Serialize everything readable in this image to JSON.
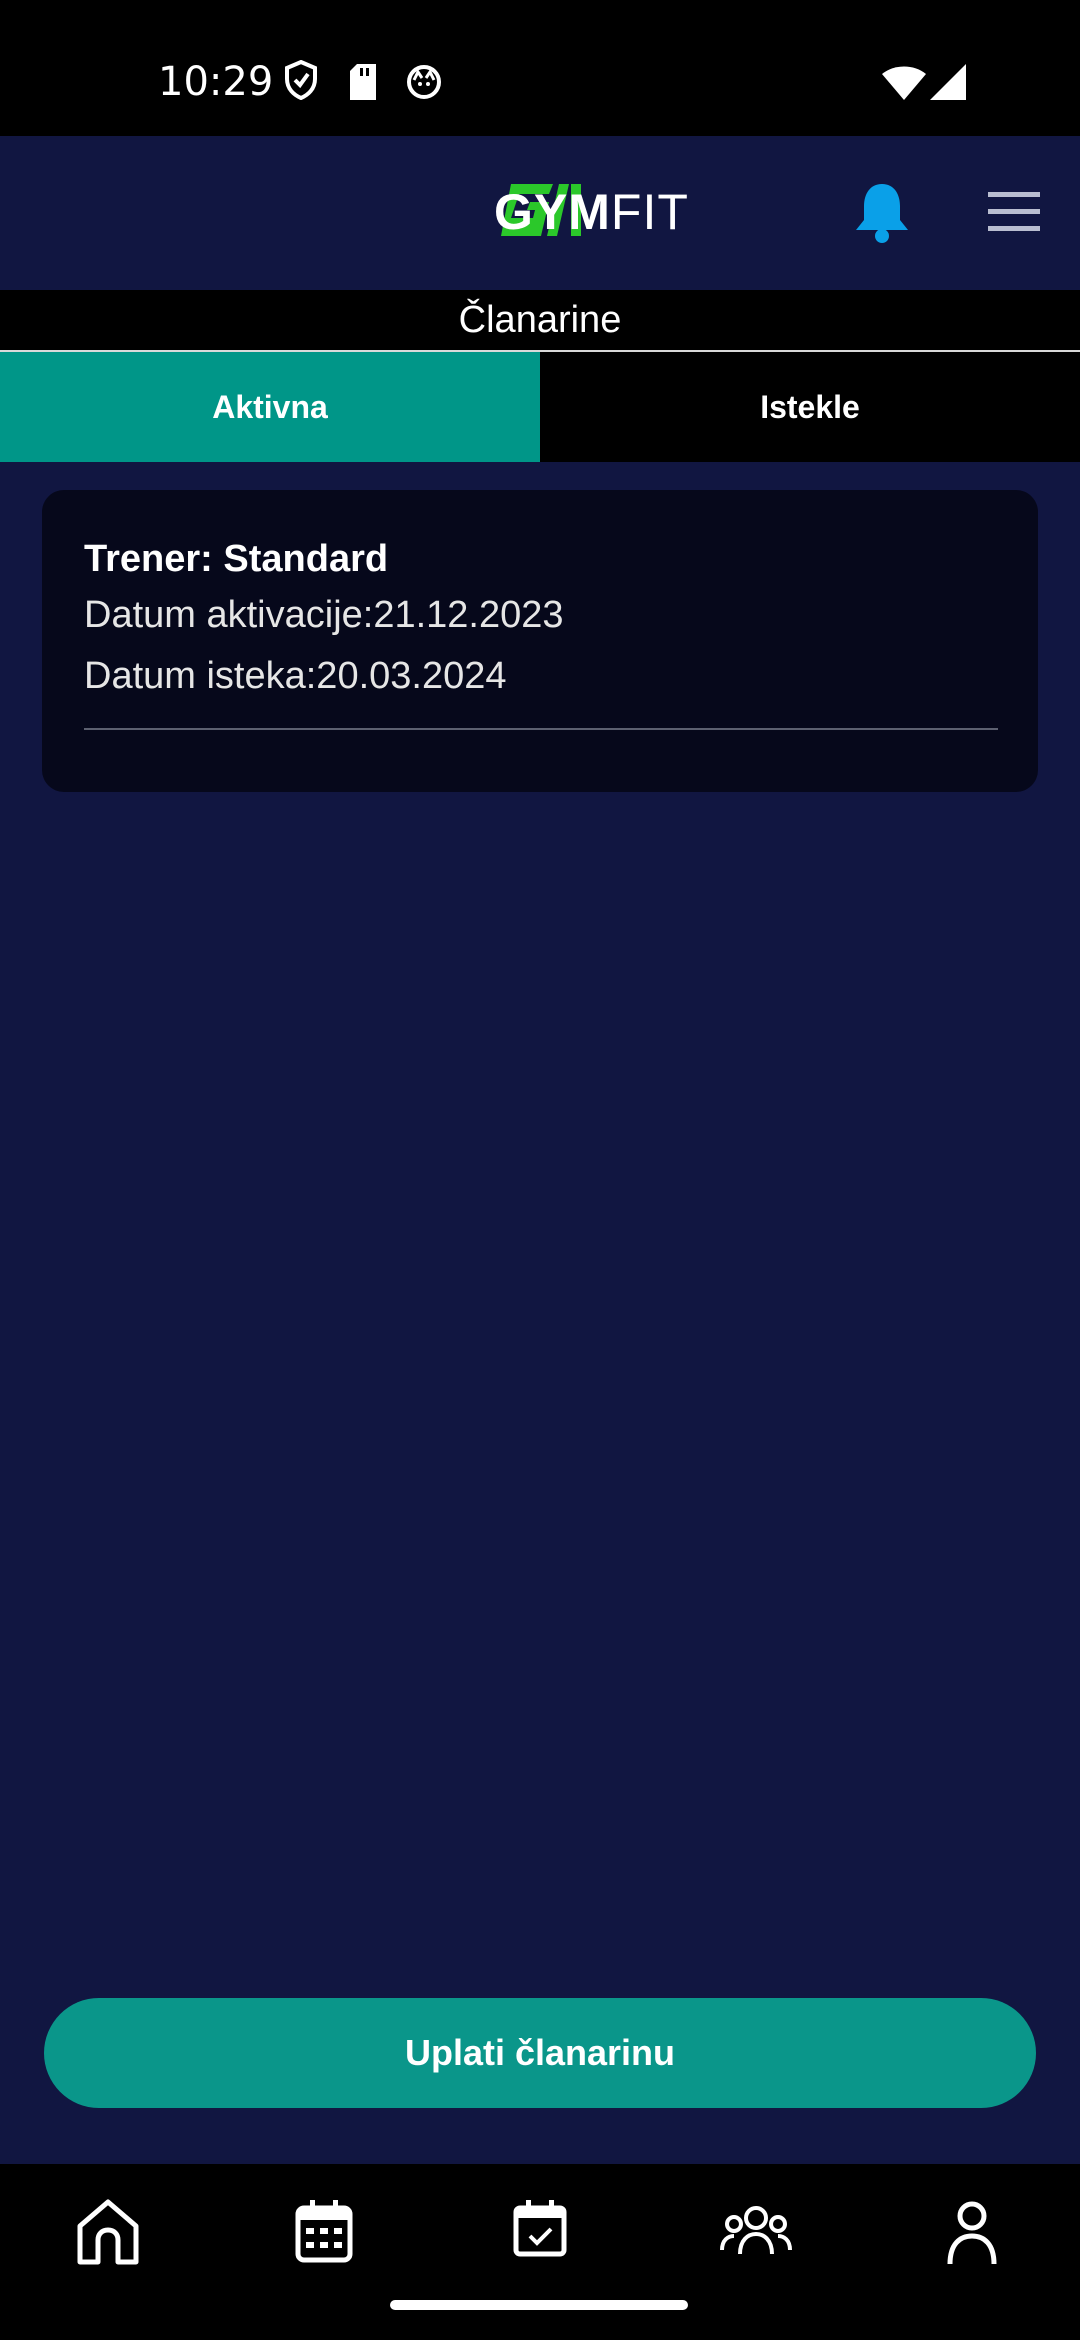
{
  "status_bar": {
    "time": "10:29",
    "left_icons": [
      "shield-icon",
      "sd-card-icon",
      "cat-face-icon"
    ],
    "right_icons": [
      "wifi-icon",
      "cellular-signal-icon"
    ]
  },
  "header": {
    "logo_text_bold": "GYM",
    "logo_text_light": "FIT",
    "logo_color": "#2bc82a",
    "notification_icon": "bell-icon",
    "notification_color": "#0aa0e8",
    "menu_icon": "hamburger-menu-icon"
  },
  "page": {
    "title": "Članarine"
  },
  "tabs": [
    {
      "label": "Aktivna",
      "active": true
    },
    {
      "label": "Istekle",
      "active": false
    }
  ],
  "membership_card": {
    "title": "Trener: Standard",
    "activation_date": "Datum aktivacije:21.12.2023",
    "expiry_date": "Datum isteka:20.03.2024"
  },
  "actions": {
    "pay_button": "Uplati članarinu"
  },
  "bottom_nav": {
    "items": [
      "home-icon",
      "calendar-grid-icon",
      "calendar-check-icon",
      "group-icon",
      "profile-icon"
    ]
  },
  "colors": {
    "background": "#111641",
    "accent": "#009688",
    "card_background": "#06081b"
  }
}
